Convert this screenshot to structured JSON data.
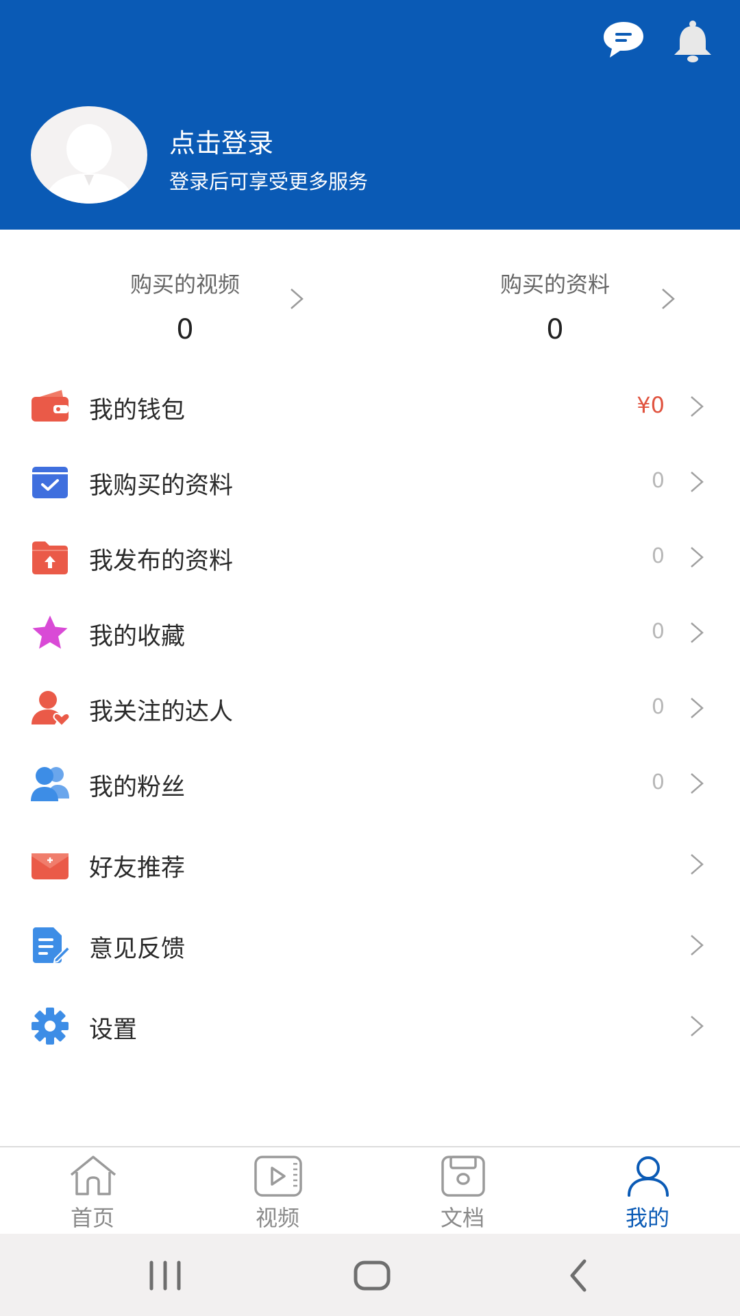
{
  "header": {
    "login_title": "点击登录",
    "login_subtitle": "登录后可享受更多服务",
    "icons": [
      "message-icon",
      "bell-icon"
    ],
    "background_color": "#0a5ab5"
  },
  "stats": [
    {
      "label": "购买的视频",
      "value": "0"
    },
    {
      "label": "购买的资料",
      "value": "0"
    }
  ],
  "menu": [
    {
      "label": "我的钱包",
      "value": "¥0",
      "icon": "wallet-icon"
    },
    {
      "label": "我购买的资料",
      "value": "0",
      "icon": "calendar-check-icon"
    },
    {
      "label": "我发布的资料",
      "value": "0",
      "icon": "folder-upload-icon"
    },
    {
      "label": "我的收藏",
      "value": "0",
      "icon": "star-icon"
    },
    {
      "label": "我关注的达人",
      "value": "0",
      "icon": "user-heart-icon"
    },
    {
      "label": "我的粉丝",
      "value": "0",
      "icon": "users-icon"
    },
    {
      "label": "好友推荐",
      "value": "",
      "icon": "envelope-icon"
    },
    {
      "label": "意见反馈",
      "value": "",
      "icon": "feedback-icon"
    },
    {
      "label": "设置",
      "value": "",
      "icon": "gear-icon"
    }
  ],
  "tabs": [
    {
      "label": "首页",
      "icon": "home-icon",
      "active": false
    },
    {
      "label": "视频",
      "icon": "video-icon",
      "active": false
    },
    {
      "label": "文档",
      "icon": "document-icon",
      "active": false
    },
    {
      "label": "我的",
      "icon": "user-icon",
      "active": true
    }
  ],
  "colors": {
    "accent": "#0a5ab5",
    "money": "#e0533f",
    "inactive_tab": "#8a8a8a"
  }
}
